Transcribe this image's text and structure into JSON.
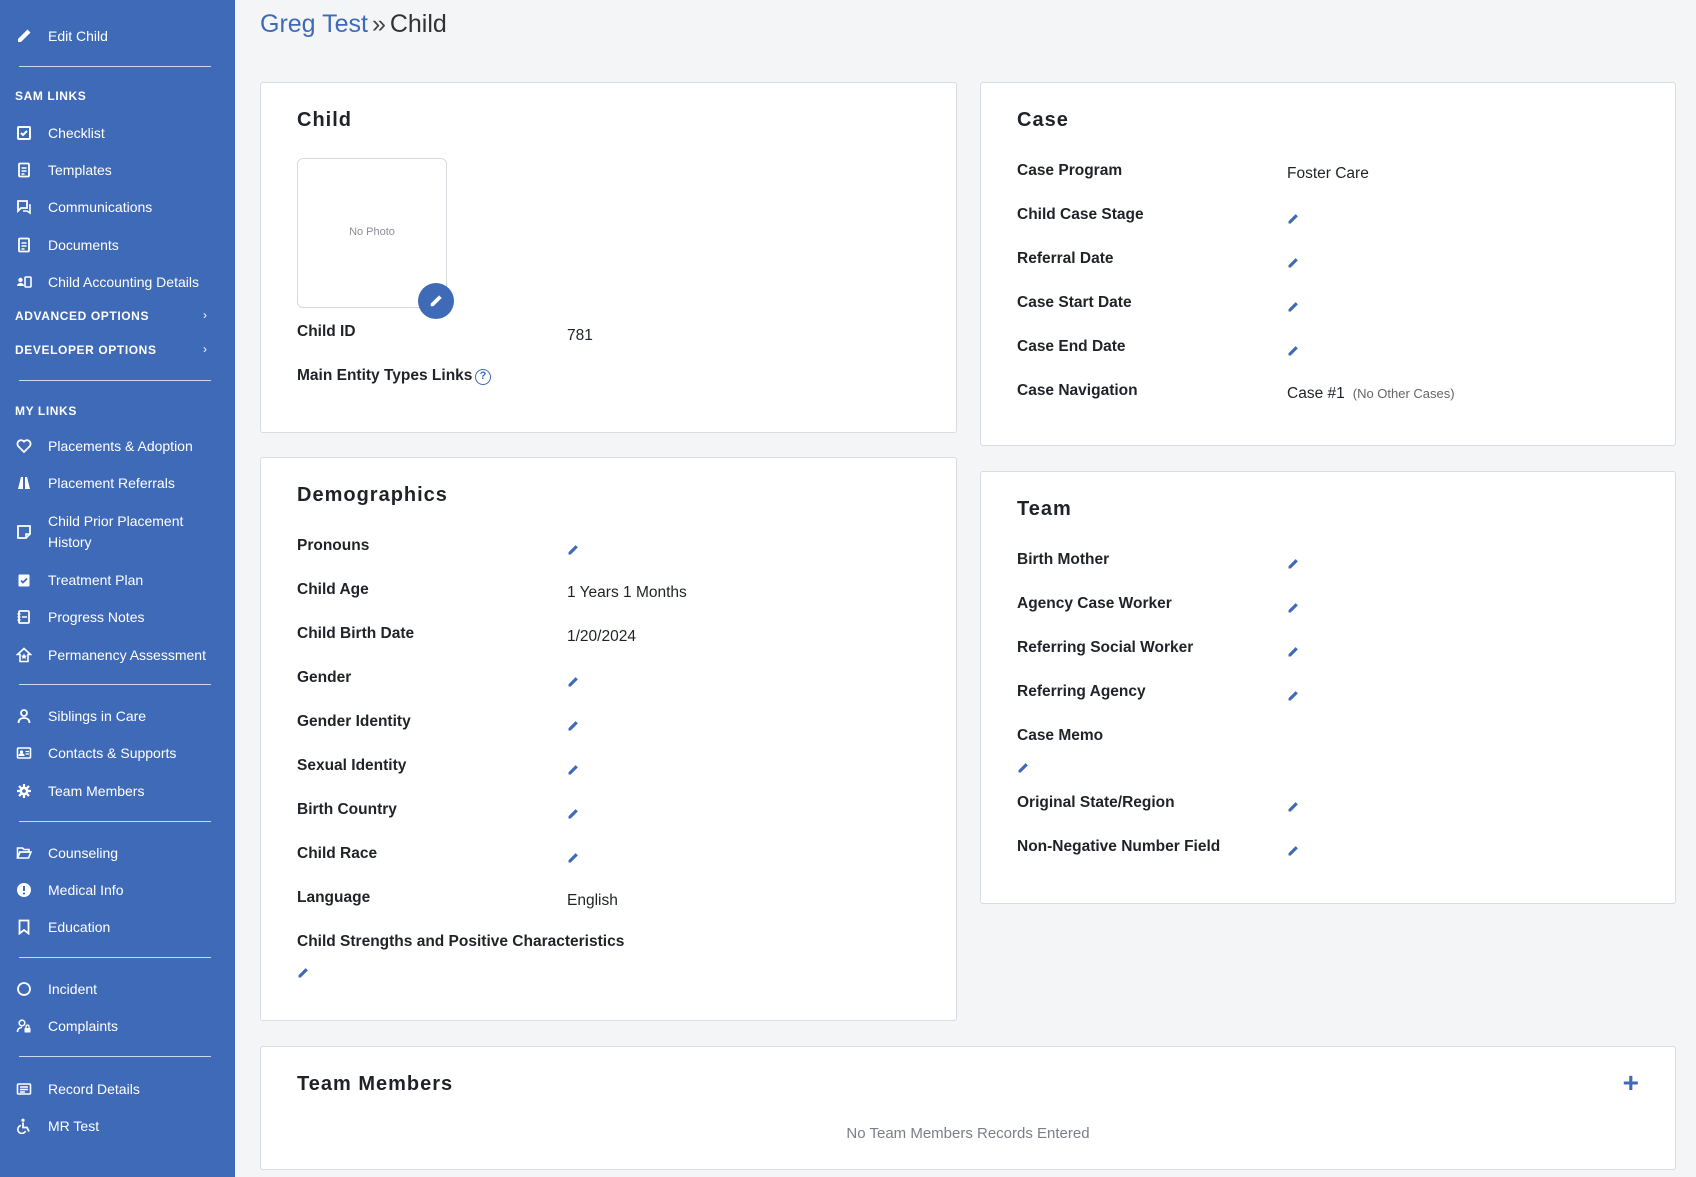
{
  "sidebar": {
    "edit_child": "Edit Child",
    "sam_links_header": "SAM LINKS",
    "sam_links": [
      "Checklist",
      "Templates",
      "Communications",
      "Documents",
      "Child Accounting Details"
    ],
    "advanced_options": "ADVANCED OPTIONS",
    "developer_options": "DEVELOPER OPTIONS",
    "my_links_header": "MY LINKS",
    "group1": [
      "Placements & Adoption",
      "Placement Referrals",
      "Child Prior Placement History",
      "Treatment Plan",
      "Progress Notes",
      "Permanency Assessment"
    ],
    "group2": [
      "Siblings in Care",
      "Contacts & Supports",
      "Team Members"
    ],
    "group3": [
      "Counseling",
      "Medical Info",
      "Education"
    ],
    "group4": [
      "Incident",
      "Complaints"
    ],
    "group5": [
      "Record Details",
      "MR Test"
    ]
  },
  "breadcrumb": {
    "parent": "Greg Test",
    "separator": "»",
    "current": "Child"
  },
  "child_card": {
    "title": "Child",
    "no_photo": "No Photo",
    "child_id_label": "Child ID",
    "child_id_value": "781",
    "main_entity_label": "Main Entity Types Links",
    "help_glyph": "?"
  },
  "case_card": {
    "title": "Case",
    "case_program_label": "Case Program",
    "case_program_value": "Foster Care",
    "child_case_stage_label": "Child Case Stage",
    "referral_date_label": "Referral Date",
    "case_start_date_label": "Case Start Date",
    "case_end_date_label": "Case End Date",
    "case_navigation_label": "Case Navigation",
    "case_navigation_value": "Case #1",
    "case_navigation_note": "(No Other Cases)"
  },
  "demographics_card": {
    "title": "Demographics",
    "pronouns_label": "Pronouns",
    "child_age_label": "Child Age",
    "child_age_value": "1 Years 1 Months",
    "birth_date_label": "Child Birth Date",
    "birth_date_value": "1/20/2024",
    "gender_label": "Gender",
    "gender_identity_label": "Gender Identity",
    "sexual_identity_label": "Sexual Identity",
    "birth_country_label": "Birth Country",
    "child_race_label": "Child Race",
    "language_label": "Language",
    "language_value": "English",
    "strengths_label": "Child Strengths and Positive Characteristics"
  },
  "team_card": {
    "title": "Team",
    "birth_mother_label": "Birth Mother",
    "agency_case_worker_label": "Agency Case Worker",
    "referring_social_worker_label": "Referring Social Worker",
    "referring_agency_label": "Referring Agency",
    "case_memo_label": "Case Memo",
    "original_state_label": "Original State/Region",
    "non_negative_label": "Non-Negative Number Field"
  },
  "team_members_card": {
    "title": "Team Members",
    "add_glyph": "+",
    "empty_message": "No Team Members Records Entered"
  },
  "colors": {
    "sidebar": "#3f6ab8",
    "accent": "#3f6ab8",
    "background": "#f4f5f7"
  }
}
